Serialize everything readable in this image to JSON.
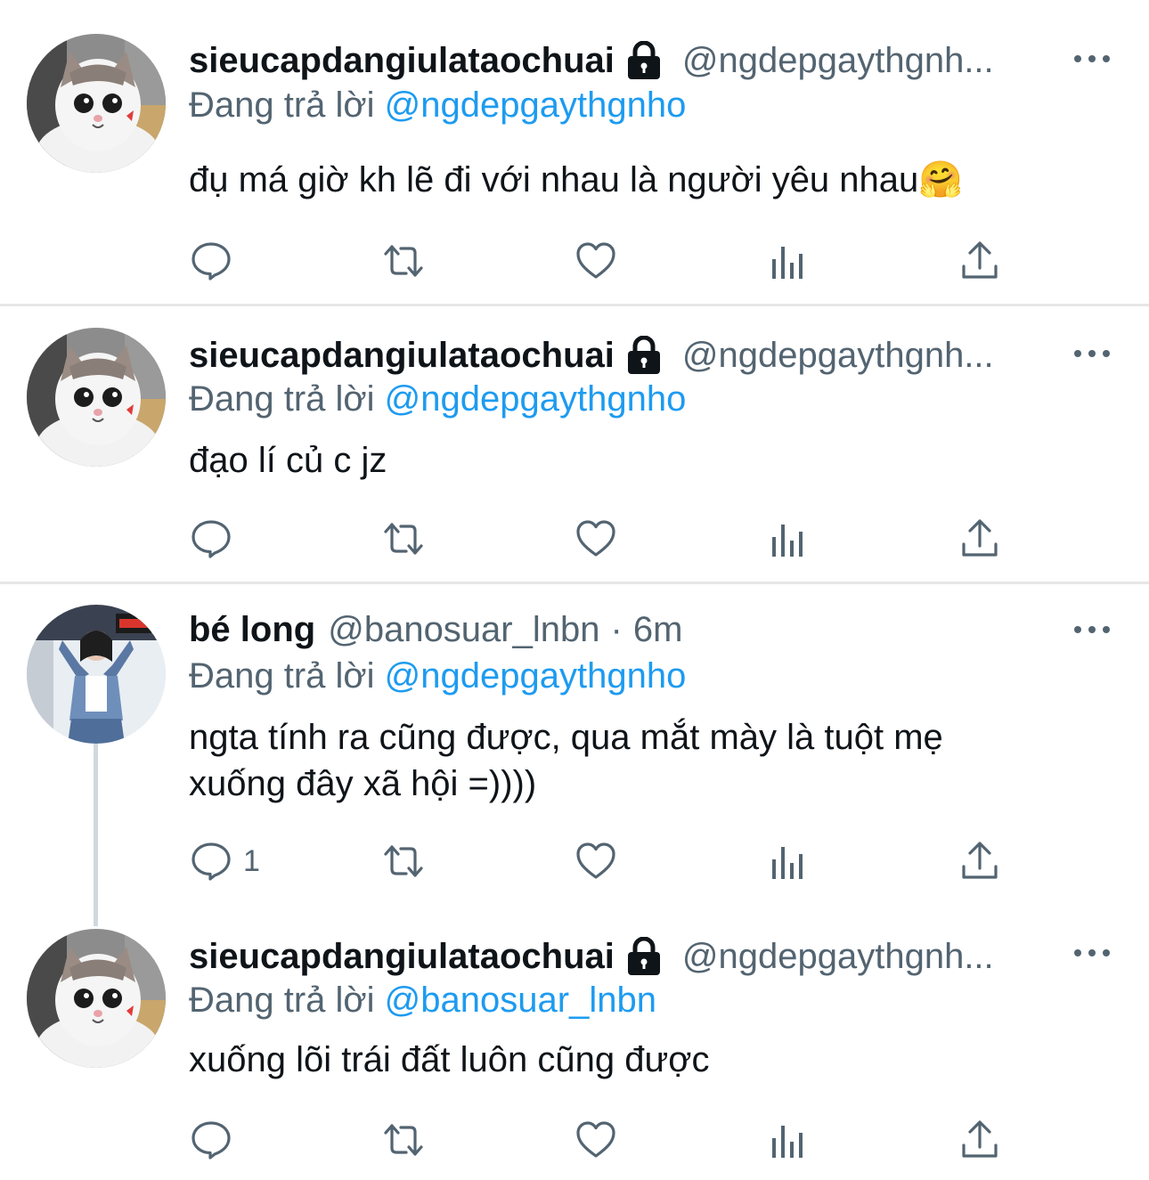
{
  "colors": {
    "link": "#1d9bf0",
    "secondary_text": "#536471",
    "primary_text": "#0f1419",
    "divider": "#e6e6e6"
  },
  "icons": [
    "lock-icon",
    "more-icon",
    "reply-icon",
    "retweet-icon",
    "like-icon",
    "analytics-icon",
    "share-icon"
  ],
  "tweets": [
    {
      "name": "sieucapdangiulataochuai",
      "handle": "@ngdepgaythgnh...",
      "reply_prefix": "Đang trả lời",
      "reply_to": "@ngdepgaythgnho",
      "text": "đụ má giờ kh lẽ đi với nhau là người yêu nhau🤗",
      "avatar": "cat-photo",
      "protected": true
    },
    {
      "name": "sieucapdangiulataochuai",
      "handle": "@ngdepgaythgnh...",
      "reply_prefix": "Đang trả lời",
      "reply_to": "@ngdepgaythgnho",
      "text": "đạo lí củ c jz",
      "avatar": "cat-photo",
      "protected": true
    },
    {
      "name": "bé long",
      "handle": "@banosuar_lnbn",
      "separator": "·",
      "time": "6m",
      "reply_prefix": "Đang trả lời",
      "reply_to": "@ngdepgaythgnho",
      "text_line1": "ngta tính ra cũng được, qua mắt mày là tuột mẹ",
      "text_line2": "xuống đây xã hội =))))",
      "reply_count": "1",
      "avatar": "person-photo",
      "protected": false
    },
    {
      "name": "sieucapdangiulataochuai",
      "handle": "@ngdepgaythgnh...",
      "reply_prefix": "Đang trả lời",
      "reply_to": "@banosuar_lnbn",
      "text": "xuống lõi trái đất luôn cũng được",
      "avatar": "cat-photo",
      "protected": true
    }
  ]
}
